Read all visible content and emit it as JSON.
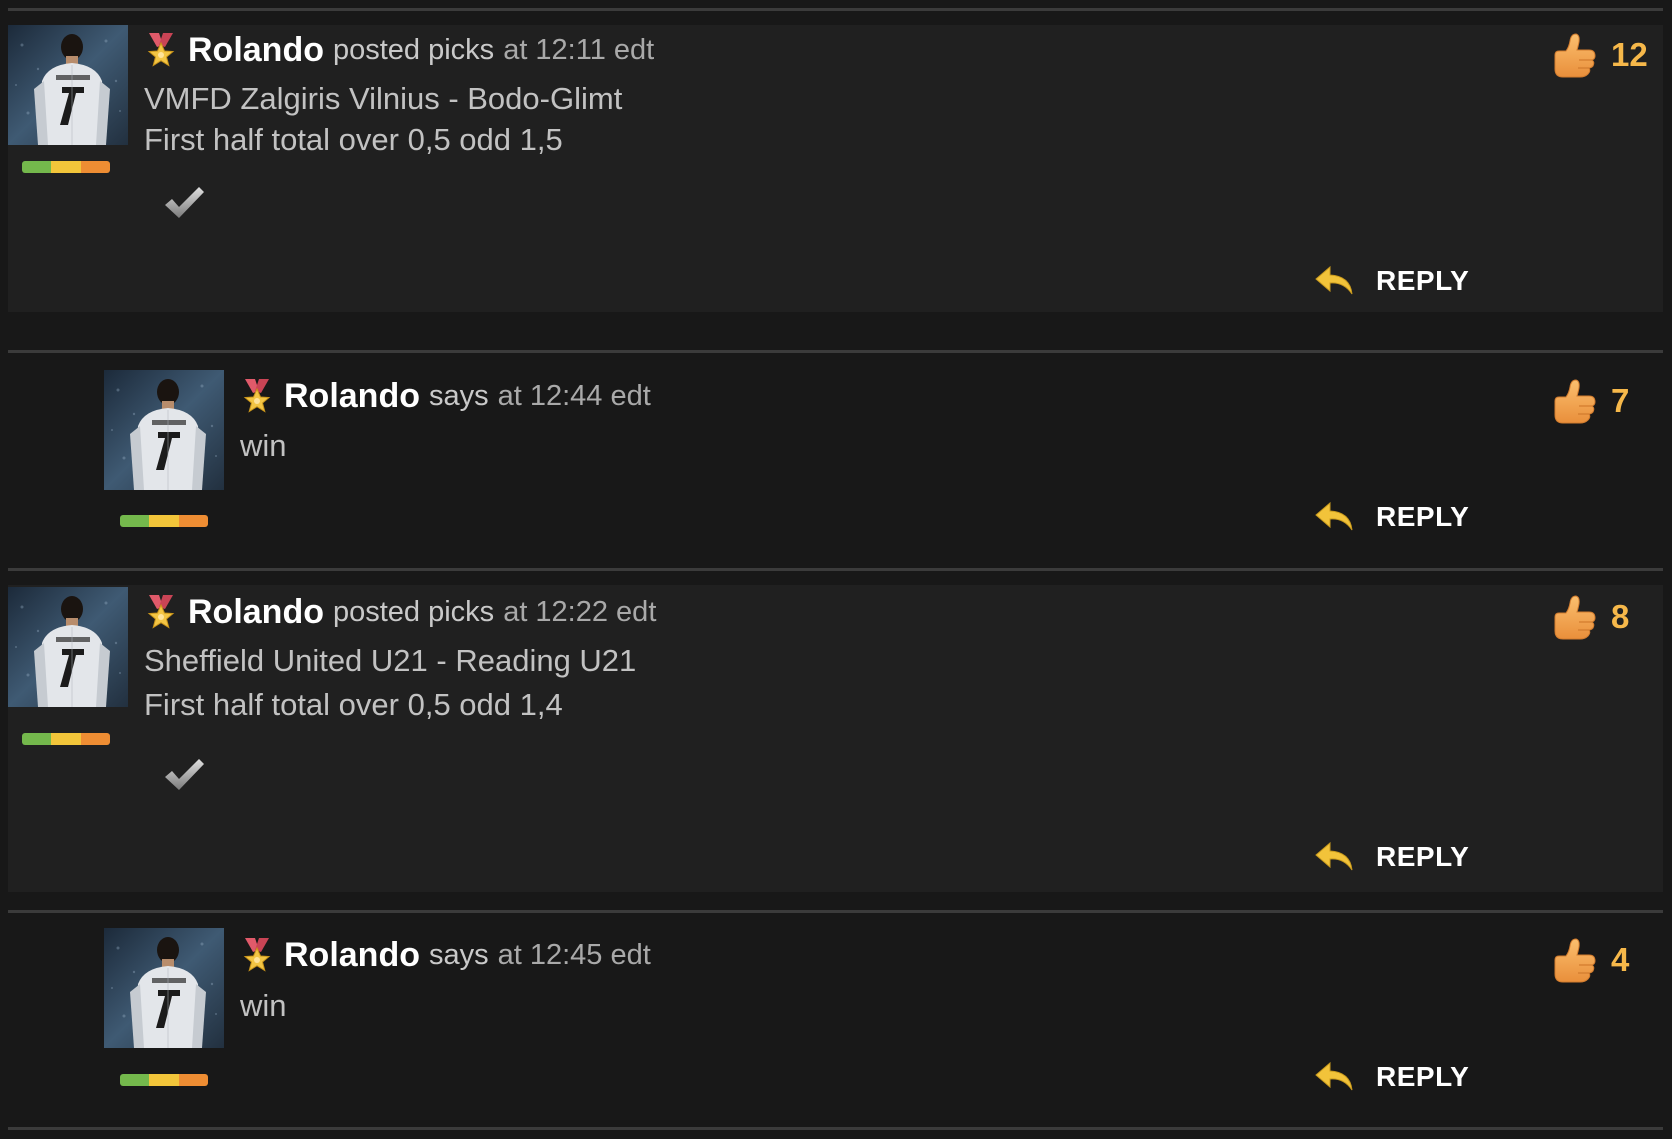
{
  "posts": [
    {
      "username": "Rolando",
      "action": "posted picks",
      "time": "at 12:11 edt",
      "match": "VMFD Zalgiris Vilnius - Bodo-Glimt",
      "pick": "First half total over 0,5 odd 1,5",
      "likes": "12",
      "reply_label": "REPLY"
    },
    {
      "username": "Rolando",
      "action": "says",
      "time": "at 12:44 edt",
      "text": "win",
      "likes": "7",
      "reply_label": "REPLY"
    },
    {
      "username": "Rolando",
      "action": "posted picks",
      "time": "at 12:22 edt",
      "match": "Sheffield United U21 - Reading U21",
      "pick": "First half total over 0,5 odd 1,4",
      "likes": "8",
      "reply_label": "REPLY"
    },
    {
      "username": "Rolando",
      "action": "says",
      "time": "at 12:45 edt",
      "text": "win",
      "likes": "4",
      "reply_label": "REPLY"
    }
  ],
  "icons": {
    "medal": "medal-icon",
    "like": "thumbs-up-icon",
    "reply": "reply-arrow-icon",
    "check": "checkmark-icon",
    "avatar": "player-avatar"
  },
  "colors": {
    "background": "#181818",
    "post_background": "#202020",
    "like_count": "#f6b84a",
    "reply_arrow": "#f2c33a",
    "rating_green": "#74b84c",
    "rating_yellow": "#f2c53a",
    "rating_orange": "#ee8d33"
  }
}
